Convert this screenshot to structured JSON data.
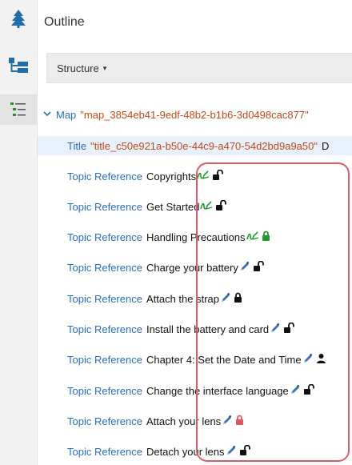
{
  "panel": {
    "title": "Outline"
  },
  "structure_dropdown": {
    "label": "Structure",
    "caret": "▾"
  },
  "rail": {
    "icons": [
      "tree-icon",
      "map-hierarchy-icon",
      "outline-list-icon"
    ]
  },
  "tree": {
    "map": {
      "label": "Map",
      "value": "\"map_3854eb41-9edf-48b2-b1b6-3d0498cac877\""
    },
    "title": {
      "label": "Title",
      "value": "\"title_c50e921a-b50e-44c9-a470-54d2bd9a9a50\"",
      "overflow": "D"
    },
    "topics": [
      {
        "label": "Topic Reference",
        "name": "Copyrights",
        "icons": [
          "green-edit-icon",
          "unlocked-icon"
        ]
      },
      {
        "label": "Topic Reference",
        "name": "Get Started",
        "icons": [
          "green-edit-icon",
          "unlocked-icon"
        ]
      },
      {
        "label": "Topic Reference",
        "name": "Handling Precautions",
        "icons": [
          "green-edit-icon",
          "green-lock-icon"
        ]
      },
      {
        "label": "Topic Reference",
        "name": "Charge your battery",
        "icons": [
          "pencil-icon",
          "unlocked-icon"
        ]
      },
      {
        "label": "Topic Reference",
        "name": "Attach the strap",
        "icons": [
          "pencil-icon",
          "lock-icon"
        ]
      },
      {
        "label": "Topic Reference",
        "name": "Install the battery and card",
        "icons": [
          "pencil-icon",
          "unlocked-icon"
        ]
      },
      {
        "label": "Topic Reference",
        "name": "Chapter 4: Set the Date and Time",
        "icons": [
          "pencil-icon",
          "user-icon"
        ]
      },
      {
        "label": "Topic Reference",
        "name": "Change the interface language",
        "icons": [
          "pencil-icon",
          "unlocked-icon"
        ]
      },
      {
        "label": "Topic Reference",
        "name": "Attach your lens",
        "icons": [
          "pencil-icon",
          "red-lock-icon"
        ]
      },
      {
        "label": "Topic Reference",
        "name": "Detach your lens",
        "icons": [
          "pencil-icon",
          "unlocked-icon"
        ]
      }
    ]
  },
  "colors": {
    "link": "#2a6fbe",
    "value": "#c24a1a",
    "pencil": "#3a72b8",
    "green": "#1f9a2b",
    "red": "#e0555f",
    "callout": "#e05b6a",
    "selected_row": "#e8f1fb"
  }
}
